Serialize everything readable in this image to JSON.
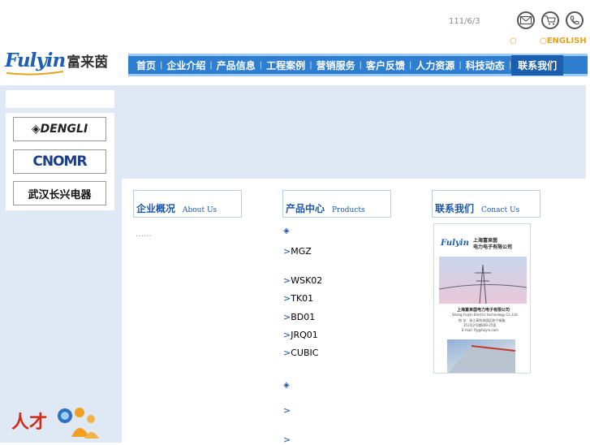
{
  "header": {
    "date": "111/6/3 ",
    "lang_cn": "○",
    "lang_en": "○ENGLISH",
    "icons": [
      "mail-icon",
      "cart-icon",
      "phone-icon"
    ]
  },
  "logo": {
    "en": "Fulyin",
    "cn": "富来茵"
  },
  "nav": {
    "items": [
      "首页",
      "企业介绍",
      "产品信息",
      "工程案例",
      "营销服务",
      "客户反馈",
      "人力资源",
      "科技动态",
      "联系我们"
    ],
    "separator": "|"
  },
  "sidebar": {
    "title": "",
    "brands": [
      "DENGLI",
      "CNOMR",
      "武汉长兴电器"
    ],
    "recruit_label": "人才",
    "marker": ""
  },
  "main": {
    "marker": "",
    "about": {
      "heading_cn": "企业概况",
      "heading_en": "About Us",
      "link_text": "",
      "text": "",
      "more": "……"
    },
    "products": {
      "heading_cn": "产品中心",
      "heading_en": "Products",
      "cat1_title": "◈",
      "items1": [
        ">MGZ\n",
        ">WSK02",
        ">TK01",
        ">BD01",
        ">JRQ01",
        ">CUBIC"
      ],
      "cat2_title": "◈",
      "items2": [
        ">",
        ">"
      ]
    },
    "contact": {
      "heading_cn": "联系我们",
      "heading_en": "Conact Us",
      "card_logo": "Fulyin",
      "card_company": "上海富来茵\n电力电子有限公司",
      "card_company_small": "上海富来茵电力电子有限公司",
      "card_en": "Shang Fulyin Electric technology Co.,Ltd.",
      "card_addr": "地 址：浙江高科技园区前宁街路",
      "card_addr2": "351号2号楼809-25室",
      "card_email": "E-mail: fly@fulyin.com"
    }
  },
  "colors": {
    "nav_blue": "#2f7fd1",
    "link_blue": "#1e56a8",
    "lang_orange": "#e8a21b",
    "panel_bg": "#dfe9f5"
  }
}
